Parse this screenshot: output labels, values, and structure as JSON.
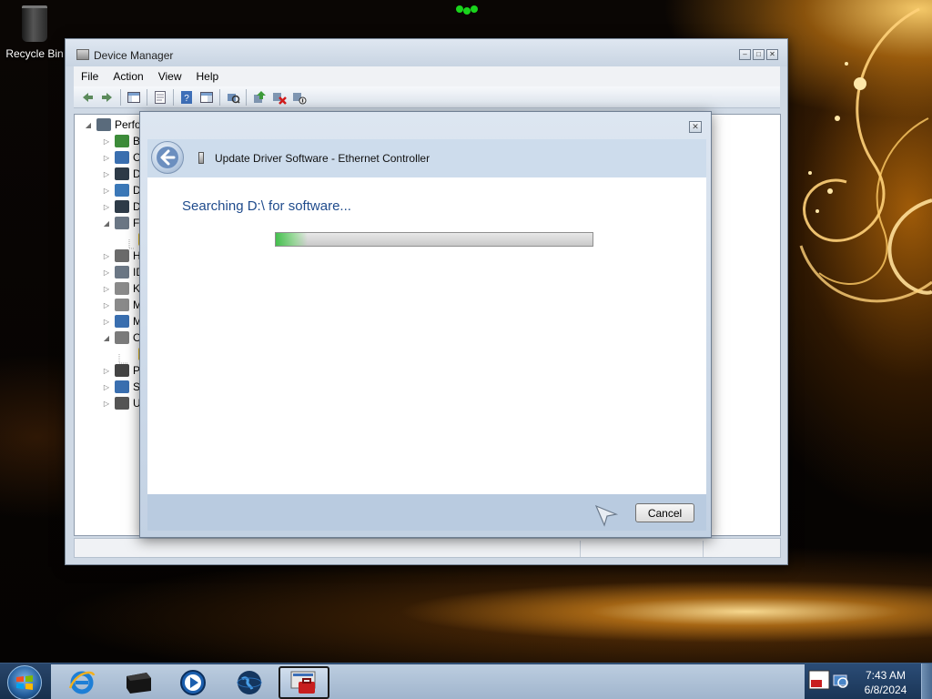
{
  "desktop": {
    "icons": [
      {
        "label": "Recycle Bin",
        "icon": "recycle-bin-icon"
      }
    ]
  },
  "device_manager": {
    "title": "Device Manager",
    "menu": [
      "File",
      "Action",
      "View",
      "Help"
    ],
    "toolbar_icons": [
      "back-arrow-icon",
      "forward-arrow-icon",
      "show-hide-console-tree-icon",
      "properties-icon",
      "help-icon",
      "action-pane-icon",
      "scan-hardware-icon",
      "update-driver-icon",
      "uninstall-icon",
      "disable-icon"
    ],
    "tree": [
      {
        "label": "Perfo",
        "expander": "◢",
        "icon": "computer-icon",
        "color": "#5a6b7c"
      },
      {
        "label": "Ba",
        "expander": "▷",
        "icon": "battery-icon",
        "color": "#3d8c3a"
      },
      {
        "label": "C",
        "expander": "▷",
        "icon": "computer-icon",
        "color": "#3a6fb0"
      },
      {
        "label": "D",
        "expander": "▷",
        "icon": "disk-drive-icon",
        "color": "#2e3b48"
      },
      {
        "label": "D",
        "expander": "▷",
        "icon": "display-adapter-icon",
        "color": "#3b78b8"
      },
      {
        "label": "D",
        "expander": "▷",
        "icon": "dvd-drive-icon",
        "color": "#2e3b48"
      },
      {
        "label": "Fl",
        "expander": "◢",
        "icon": "floppy-controller-icon",
        "color": "#6b7785"
      },
      {
        "label": "",
        "expander": "",
        "icon": "warning-device-icon",
        "color": "#e3b81f"
      },
      {
        "label": "H",
        "expander": "▷",
        "icon": "human-interface-icon",
        "color": "#6b6b6b"
      },
      {
        "label": "ID",
        "expander": "▷",
        "icon": "ide-controller-icon",
        "color": "#6b7785"
      },
      {
        "label": "Ke",
        "expander": "▷",
        "icon": "keyboard-icon",
        "color": "#8a8a8a"
      },
      {
        "label": "M",
        "expander": "▷",
        "icon": "mouse-icon",
        "color": "#8a8a8a"
      },
      {
        "label": "M",
        "expander": "▷",
        "icon": "monitor-icon",
        "color": "#3a6fb0"
      },
      {
        "label": "O",
        "expander": "◢",
        "icon": "other-devices-icon",
        "color": "#7b7b7b"
      },
      {
        "label": "",
        "expander": "",
        "icon": "warning-device-icon",
        "color": "#e3b81f"
      },
      {
        "label": "Pr",
        "expander": "▷",
        "icon": "processor-icon",
        "color": "#444444"
      },
      {
        "label": "Sy",
        "expander": "▷",
        "icon": "system-devices-icon",
        "color": "#3a6fb0"
      },
      {
        "label": "U",
        "expander": "▷",
        "icon": "usb-controller-icon",
        "color": "#555555"
      }
    ]
  },
  "dialog": {
    "title": "Update Driver Software - Ethernet Controller",
    "heading": "Searching D:\\ for software...",
    "progress": 0.1,
    "cancel_label": "Cancel",
    "close_glyph": "✕"
  },
  "taskbar": {
    "pinned": [
      "internet-explorer-icon",
      "device-icon",
      "media-player-icon",
      "network-globe-icon",
      "device-manager-icon"
    ],
    "active_index": 4,
    "clock_time": "7:43 AM",
    "clock_date": "6/8/2024"
  },
  "colors": {
    "heading": "#1f4b8c",
    "progress_fill": "#3cbe46",
    "taskbar": "#1c3756"
  }
}
